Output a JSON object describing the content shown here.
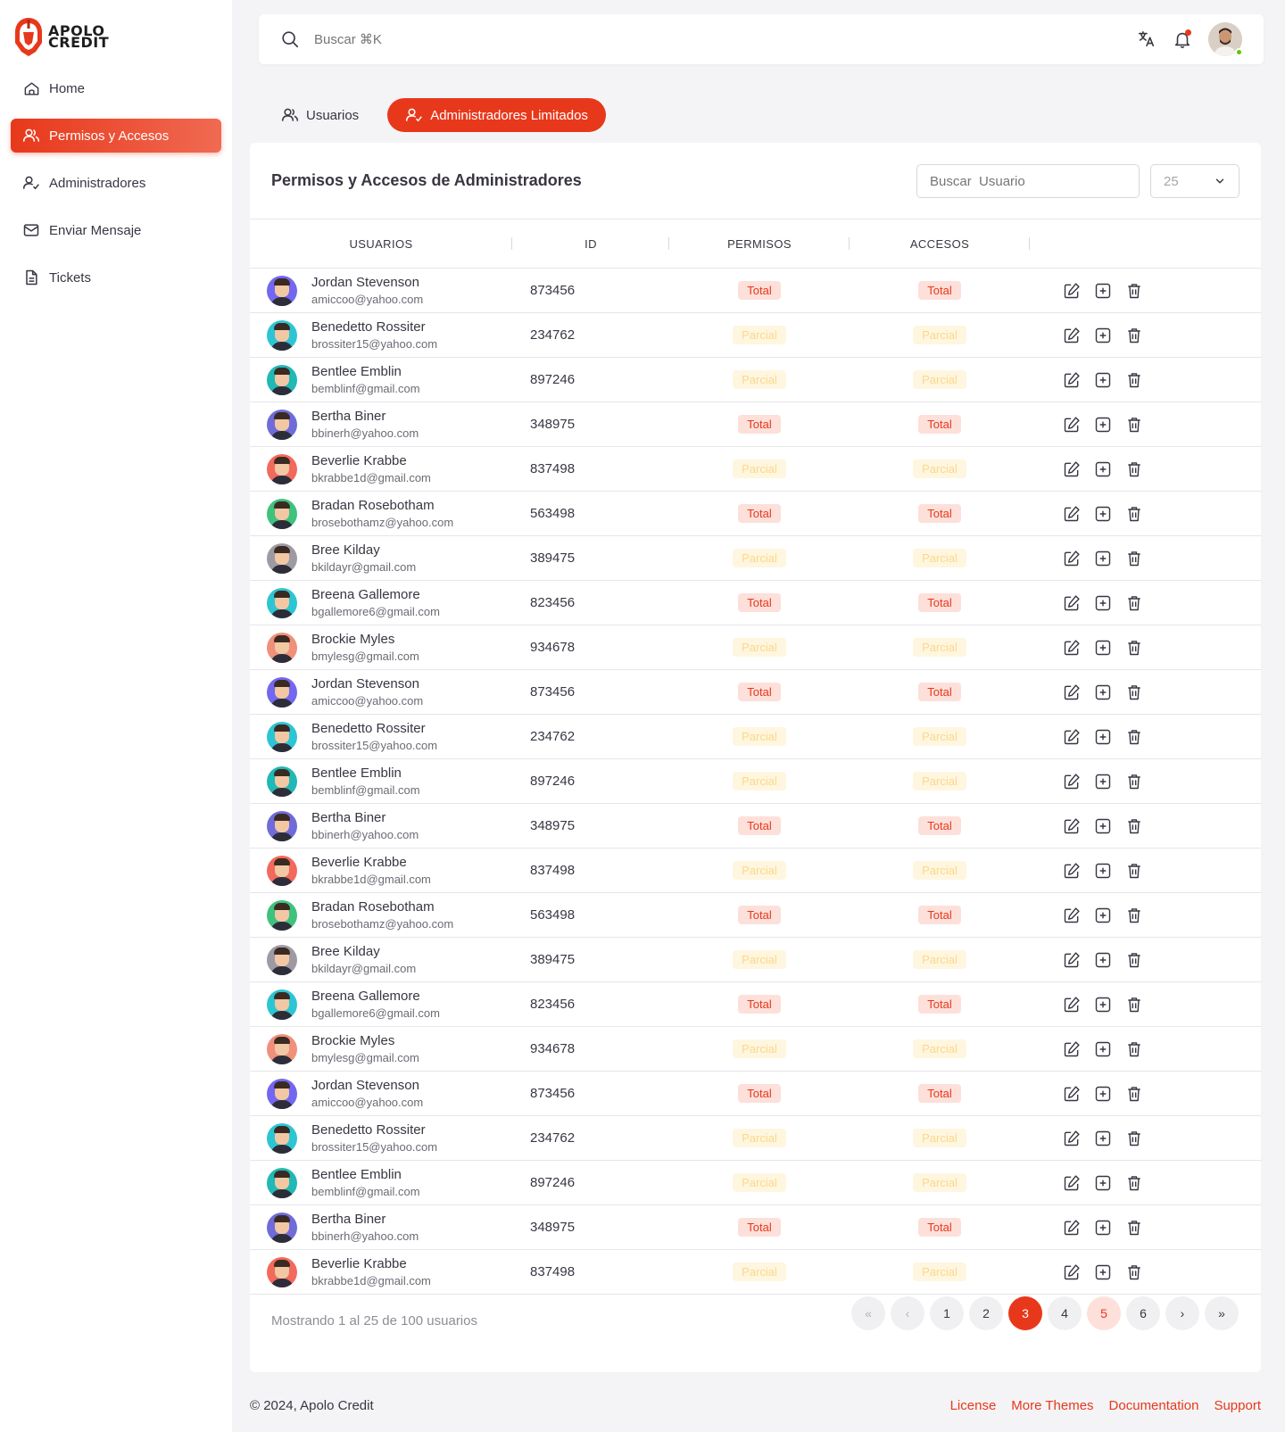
{
  "brand": {
    "line1": "APOLO",
    "line2": "CREDIT"
  },
  "sidebar": {
    "items": [
      {
        "label": "Home",
        "icon": "home-icon"
      },
      {
        "label": "Permisos y Accesos",
        "icon": "users-icon",
        "active": true
      },
      {
        "label": "Administradores",
        "icon": "user-check-icon"
      },
      {
        "label": "Enviar Mensaje",
        "icon": "mail-icon"
      },
      {
        "label": "Tickets",
        "icon": "file-icon"
      }
    ]
  },
  "header": {
    "search_placeholder": "Buscar ⌘K"
  },
  "tabs": [
    {
      "label": "Usuarios",
      "active": false
    },
    {
      "label": "Administradores Limitados",
      "active": true
    }
  ],
  "card": {
    "title": "Permisos y Accesos de Administradores",
    "search_placeholder": "Buscar  Usuario",
    "page_size": "25"
  },
  "table": {
    "columns": [
      "USUARIOS",
      "ID",
      "PERMISOS",
      "ACCESOS"
    ],
    "rows": [
      {
        "name": "Jordan Stevenson",
        "email": "amiccoo@yahoo.com",
        "id": "873456",
        "permisos": "Total",
        "accesos": "Total",
        "bg": "#7367f0"
      },
      {
        "name": "Benedetto Rossiter",
        "email": "brossiter15@yahoo.com",
        "id": "234762",
        "permisos": "Parcial",
        "accesos": "Parcial",
        "bg": "#2ec5d3"
      },
      {
        "name": "Bentlee Emblin",
        "email": "bemblinf@gmail.com",
        "id": "897246",
        "permisos": "Parcial",
        "accesos": "Parcial",
        "bg": "#21b8b5"
      },
      {
        "name": "Bertha Biner",
        "email": "bbinerh@yahoo.com",
        "id": "348975",
        "permisos": "Total",
        "accesos": "Total",
        "bg": "#6f6cd8"
      },
      {
        "name": "Beverlie Krabbe",
        "email": "bkrabbe1d@gmail.com",
        "id": "837498",
        "permisos": "Parcial",
        "accesos": "Parcial",
        "bg": "#f26a5b"
      },
      {
        "name": "Bradan Rosebotham",
        "email": "brosebothamz@yahoo.com",
        "id": "563498",
        "permisos": "Total",
        "accesos": "Total",
        "bg": "#3fc27e"
      },
      {
        "name": "Bree Kilday",
        "email": "bkildayr@gmail.com",
        "id": "389475",
        "permisos": "Parcial",
        "accesos": "Parcial",
        "bg": "#9e9aa3"
      },
      {
        "name": "Breena Gallemore",
        "email": "bgallemore6@gmail.com",
        "id": "823456",
        "permisos": "Total",
        "accesos": "Total",
        "bg": "#2ec5d3"
      },
      {
        "name": "Brockie Myles",
        "email": "bmylesg@gmail.com",
        "id": "934678",
        "permisos": "Parcial",
        "accesos": "Parcial",
        "bg": "#f0907a"
      },
      {
        "name": "Jordan Stevenson",
        "email": "amiccoo@yahoo.com",
        "id": "873456",
        "permisos": "Total",
        "accesos": "Total",
        "bg": "#7367f0"
      },
      {
        "name": "Benedetto Rossiter",
        "email": "brossiter15@yahoo.com",
        "id": "234762",
        "permisos": "Parcial",
        "accesos": "Parcial",
        "bg": "#2ec5d3"
      },
      {
        "name": "Bentlee Emblin",
        "email": "bemblinf@gmail.com",
        "id": "897246",
        "permisos": "Parcial",
        "accesos": "Parcial",
        "bg": "#21b8b5"
      },
      {
        "name": "Bertha Biner",
        "email": "bbinerh@yahoo.com",
        "id": "348975",
        "permisos": "Total",
        "accesos": "Total",
        "bg": "#6f6cd8"
      },
      {
        "name": "Beverlie Krabbe",
        "email": "bkrabbe1d@gmail.com",
        "id": "837498",
        "permisos": "Parcial",
        "accesos": "Parcial",
        "bg": "#f26a5b"
      },
      {
        "name": "Bradan Rosebotham",
        "email": "brosebothamz@yahoo.com",
        "id": "563498",
        "permisos": "Total",
        "accesos": "Total",
        "bg": "#3fc27e"
      },
      {
        "name": "Bree Kilday",
        "email": "bkildayr@gmail.com",
        "id": "389475",
        "permisos": "Parcial",
        "accesos": "Parcial",
        "bg": "#9e9aa3"
      },
      {
        "name": "Breena Gallemore",
        "email": "bgallemore6@gmail.com",
        "id": "823456",
        "permisos": "Total",
        "accesos": "Total",
        "bg": "#2ec5d3"
      },
      {
        "name": "Brockie Myles",
        "email": "bmylesg@gmail.com",
        "id": "934678",
        "permisos": "Parcial",
        "accesos": "Parcial",
        "bg": "#f0907a"
      },
      {
        "name": "Jordan Stevenson",
        "email": "amiccoo@yahoo.com",
        "id": "873456",
        "permisos": "Total",
        "accesos": "Total",
        "bg": "#7367f0"
      },
      {
        "name": "Benedetto Rossiter",
        "email": "brossiter15@yahoo.com",
        "id": "234762",
        "permisos": "Parcial",
        "accesos": "Parcial",
        "bg": "#2ec5d3"
      },
      {
        "name": "Bentlee Emblin",
        "email": "bemblinf@gmail.com",
        "id": "897246",
        "permisos": "Parcial",
        "accesos": "Parcial",
        "bg": "#21b8b5"
      },
      {
        "name": "Bertha Biner",
        "email": "bbinerh@yahoo.com",
        "id": "348975",
        "permisos": "Total",
        "accesos": "Total",
        "bg": "#6f6cd8"
      },
      {
        "name": "Beverlie Krabbe",
        "email": "bkrabbe1d@gmail.com",
        "id": "837498",
        "permisos": "Parcial",
        "accesos": "Parcial",
        "bg": "#f26a5b"
      }
    ]
  },
  "pagination": {
    "info": "Mostrando 1 al 25 de 100 usuarios",
    "first": "«",
    "prev": "‹",
    "next": "›",
    "last": "»",
    "pages": [
      {
        "label": "1",
        "state": "normal"
      },
      {
        "label": "2",
        "state": "normal"
      },
      {
        "label": "3",
        "state": "active"
      },
      {
        "label": "4",
        "state": "normal"
      },
      {
        "label": "5",
        "state": "light"
      },
      {
        "label": "6",
        "state": "normal"
      }
    ]
  },
  "footer": {
    "copyright": "© 2024, Apolo Credit",
    "links": [
      "License",
      "More Themes",
      "Documentation",
      "Support"
    ]
  },
  "colors": {
    "accent": "#e8381b",
    "parcial_text": "#fbd88a",
    "parcial_bg": "#fff6e0",
    "total_bg": "#fde0da"
  }
}
